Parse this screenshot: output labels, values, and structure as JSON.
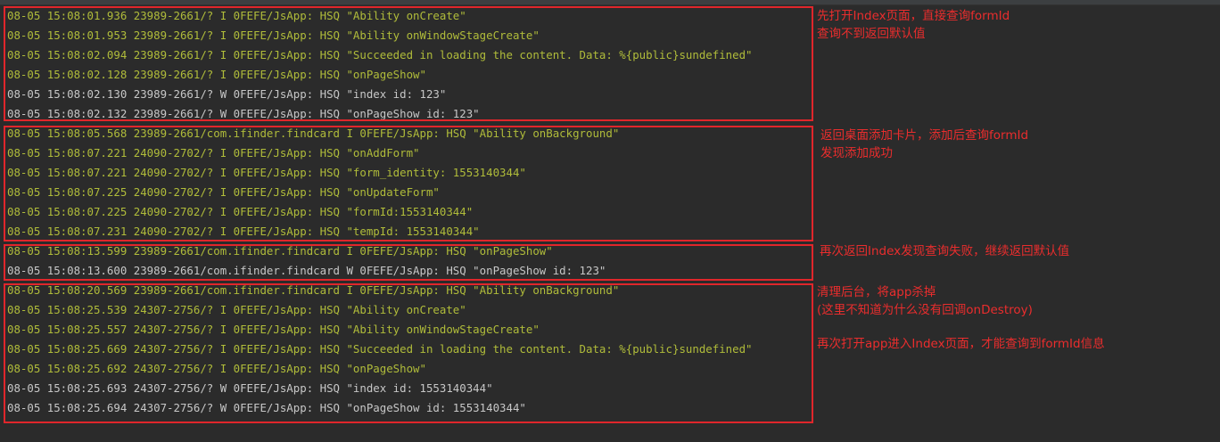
{
  "logs": [
    {
      "text": "08-05 15:08:01.936 23989-2661/? I 0FEFE/JsApp: HSQ \"Ability onCreate\"",
      "level": "I"
    },
    {
      "text": "08-05 15:08:01.953 23989-2661/? I 0FEFE/JsApp: HSQ \"Ability onWindowStageCreate\"",
      "level": "I"
    },
    {
      "text": "08-05 15:08:02.094 23989-2661/? I 0FEFE/JsApp: HSQ \"Succeeded in loading the content. Data: %{public}sundefined\"",
      "level": "I"
    },
    {
      "text": "08-05 15:08:02.128 23989-2661/? I 0FEFE/JsApp: HSQ \"onPageShow\"",
      "level": "I"
    },
    {
      "text": "08-05 15:08:02.130 23989-2661/? W 0FEFE/JsApp: HSQ \"index id: 123\"",
      "level": "W"
    },
    {
      "text": "08-05 15:08:02.132 23989-2661/? W 0FEFE/JsApp: HSQ \"onPageShow id: 123\"",
      "level": "W"
    },
    {
      "text": "08-05 15:08:05.568 23989-2661/com.ifinder.findcard I 0FEFE/JsApp: HSQ \"Ability onBackground\"",
      "level": "I"
    },
    {
      "text": "08-05 15:08:07.221 24090-2702/? I 0FEFE/JsApp: HSQ \"onAddForm\"",
      "level": "I"
    },
    {
      "text": "08-05 15:08:07.221 24090-2702/? I 0FEFE/JsApp: HSQ \"form_identity: 1553140344\"",
      "level": "I"
    },
    {
      "text": "08-05 15:08:07.225 24090-2702/? I 0FEFE/JsApp: HSQ \"onUpdateForm\"",
      "level": "I"
    },
    {
      "text": "08-05 15:08:07.225 24090-2702/? I 0FEFE/JsApp: HSQ \"formId:1553140344\"",
      "level": "I"
    },
    {
      "text": "08-05 15:08:07.231 24090-2702/? I 0FEFE/JsApp: HSQ \"tempId: 1553140344\"",
      "level": "I"
    },
    {
      "text": "08-05 15:08:13.599 23989-2661/com.ifinder.findcard I 0FEFE/JsApp: HSQ \"onPageShow\"",
      "level": "I"
    },
    {
      "text": "08-05 15:08:13.600 23989-2661/com.ifinder.findcard W 0FEFE/JsApp: HSQ \"onPageShow id: 123\"",
      "level": "W"
    },
    {
      "text": "08-05 15:08:20.569 23989-2661/com.ifinder.findcard I 0FEFE/JsApp: HSQ \"Ability onBackground\"",
      "level": "I"
    },
    {
      "text": "08-05 15:08:25.539 24307-2756/? I 0FEFE/JsApp: HSQ \"Ability onCreate\"",
      "level": "I"
    },
    {
      "text": "08-05 15:08:25.557 24307-2756/? I 0FEFE/JsApp: HSQ \"Ability onWindowStageCreate\"",
      "level": "I"
    },
    {
      "text": "08-05 15:08:25.669 24307-2756/? I 0FEFE/JsApp: HSQ \"Succeeded in loading the content. Data: %{public}sundefined\"",
      "level": "I"
    },
    {
      "text": "08-05 15:08:25.692 24307-2756/? I 0FEFE/JsApp: HSQ \"onPageShow\"",
      "level": "I"
    },
    {
      "text": "08-05 15:08:25.693 24307-2756/? W 0FEFE/JsApp: HSQ \"index id: 1553140344\"",
      "level": "W"
    },
    {
      "text": "08-05 15:08:25.694 24307-2756/? W 0FEFE/JsApp: HSQ \"onPageShow id: 1553140344\"",
      "level": "W"
    }
  ],
  "annotations": {
    "group1_line1": "先打开Index页面，直接查询formId",
    "group1_line2": "查询不到返回默认值",
    "group2_line1": "返回桌面添加卡片，添加后查询formId",
    "group2_line2": "发现添加成功",
    "group3_line1": "再次返回Index发现查询失败，继续返回默认值",
    "group4_line1": "清理后台，将app杀掉",
    "group4_line2": "(这里不知道为什么没有回调onDestroy)",
    "group4_line3": "再次打开app进入Index页面，才能查询到formId信息"
  },
  "colors": {
    "background": "#2b2b2b",
    "info_text": "#b0bc3a",
    "warn_text": "#c7c7c7",
    "annotation": "#ea2d2d"
  }
}
